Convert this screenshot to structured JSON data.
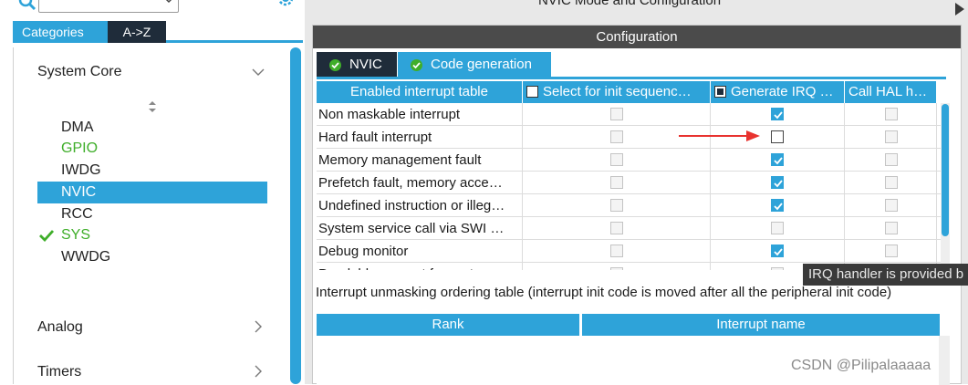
{
  "header": {
    "mode_title": "NVIC Mode and Configuration",
    "config_title": "Configuration"
  },
  "search": {
    "icon": "search-icon",
    "dropdown_icon": "chevron-down-icon",
    "settings_icon": "gear-icon"
  },
  "category_tabs": {
    "categories": "Categories",
    "atoz": "A->Z"
  },
  "sections": {
    "system_core": "System Core",
    "analog": "Analog",
    "timers": "Timers"
  },
  "system_core_items": [
    {
      "label": "DMA",
      "status": "normal"
    },
    {
      "label": "GPIO",
      "status": "configured"
    },
    {
      "label": "IWDG",
      "status": "normal"
    },
    {
      "label": "NVIC",
      "status": "selected"
    },
    {
      "label": "RCC",
      "status": "normal"
    },
    {
      "label": "SYS",
      "status": "checked"
    },
    {
      "label": "WWDG",
      "status": "normal"
    }
  ],
  "sub_tabs": {
    "nvic": "NVIC",
    "code_generation": "Code generation"
  },
  "interrupt_table": {
    "columns": [
      "Enabled interrupt table",
      "Select for init sequenc…",
      "Generate IRQ …",
      "Call HAL h…"
    ],
    "header_checkbox_states": [
      false,
      true
    ],
    "rows": [
      {
        "name": "Non maskable interrupt",
        "select_init": false,
        "generate_irq": true,
        "call_hal": false,
        "gen_enabled": true
      },
      {
        "name": "Hard fault interrupt",
        "select_init": false,
        "generate_irq": false,
        "call_hal": false,
        "gen_enabled": true
      },
      {
        "name": "Memory management fault",
        "select_init": false,
        "generate_irq": true,
        "call_hal": false,
        "gen_enabled": true
      },
      {
        "name": "Prefetch fault, memory acce…",
        "select_init": false,
        "generate_irq": true,
        "call_hal": false,
        "gen_enabled": true
      },
      {
        "name": "Undefined instruction or illeg…",
        "select_init": false,
        "generate_irq": true,
        "call_hal": false,
        "gen_enabled": true
      },
      {
        "name": "System service call via SWI …",
        "select_init": false,
        "generate_irq": false,
        "call_hal": false,
        "gen_enabled": false
      },
      {
        "name": "Debug monitor",
        "select_init": false,
        "generate_irq": true,
        "call_hal": false,
        "gen_enabled": true
      },
      {
        "name": "Pendable request for system…",
        "select_init": false,
        "generate_irq": false,
        "call_hal": false,
        "gen_enabled": false
      }
    ]
  },
  "tooltip": "IRQ handler is provided b",
  "unmask_text": "Interrupt unmasking ordering table (interrupt init code is moved after all the peripheral init code)",
  "rank_table": {
    "columns": [
      "Rank",
      "Interrupt name"
    ]
  },
  "watermark": "CSDN @Pilipalaaaaa",
  "colors": {
    "accent": "#2ea3d9",
    "dark": "#1f2c3a",
    "green": "#3fae2a",
    "arrow": "#e8332f"
  }
}
